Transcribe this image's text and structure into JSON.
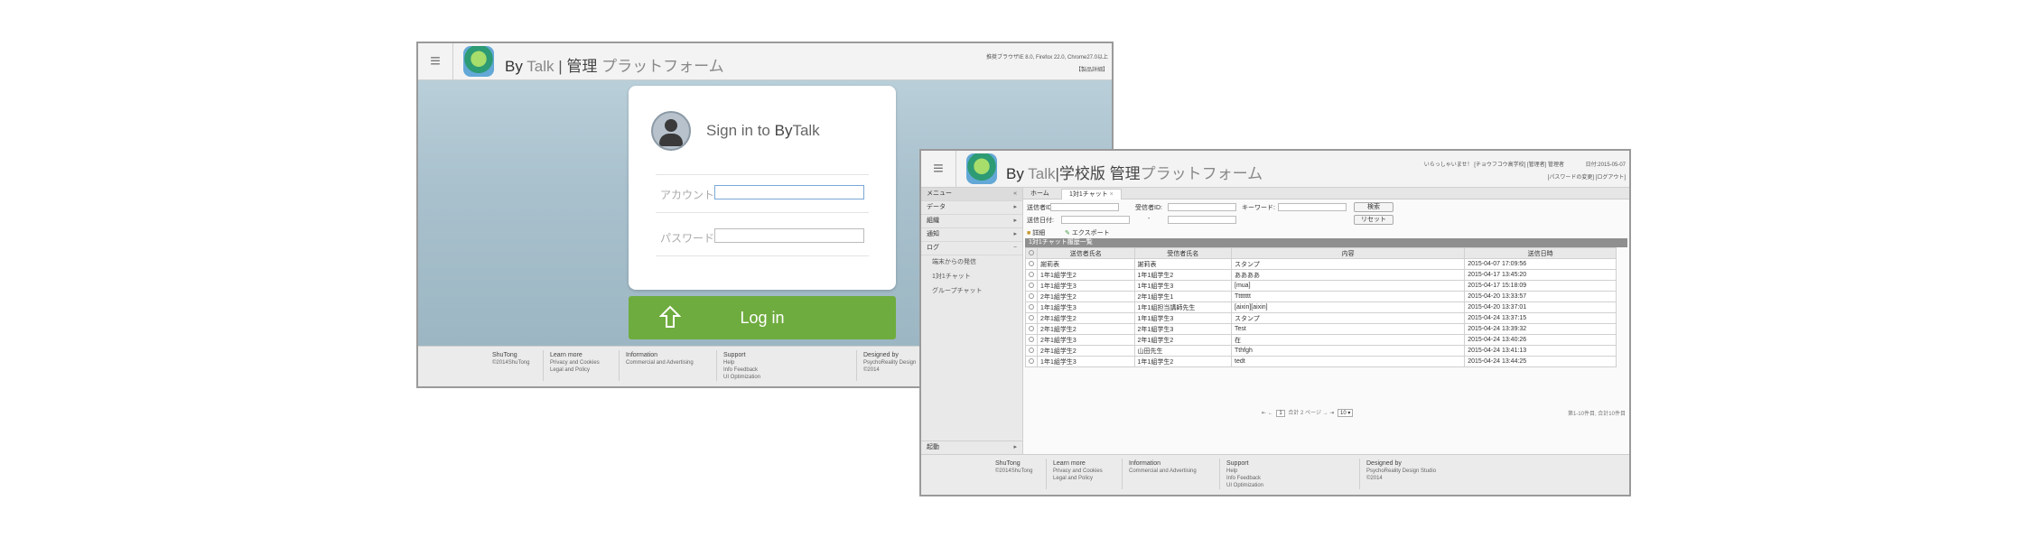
{
  "login_window": {
    "brand": {
      "by": "By",
      "talk": "Talk",
      "sep": "|",
      "admin": "管理",
      "platform": "プラットフォーム"
    },
    "browser_note": "推奨ブラウザIE 8.0, Firefox 22.0, Chrome27.0以上",
    "help_link": "【製品詳細】",
    "signin": {
      "prefix": "Sign in to ",
      "by": "By",
      "talk": "Talk"
    },
    "account_label": "アカウント",
    "password_label": "パスワード",
    "login_button": "Log in",
    "footer": {
      "company": "ShuTong",
      "copyright": "©2014ShuTong",
      "learn": {
        "title": "Learn more",
        "items": [
          "Privacy and Cookies",
          "Legal and Policy"
        ]
      },
      "info": {
        "title": "Information",
        "items": [
          "Commercial and Advertising"
        ]
      },
      "support": {
        "title": "Support",
        "items": [
          "Help",
          "Info Feedback",
          "UI Optimization"
        ]
      },
      "designed": {
        "title": "Designed by",
        "items": [
          "PsychoReality Design",
          "©2014"
        ]
      }
    }
  },
  "admin_window": {
    "brand": {
      "by": "By",
      "talk": "Talk",
      "sep": "|",
      "school": "学校版",
      "admin": "管理",
      "platform": "プラットフォーム"
    },
    "user_info": "いらっしゃいませ！ [チョウフコウ高学校] [管理者] 管理者",
    "date": "日付:2015-05-07",
    "links": "[パスワードの変更] [ログアウト]",
    "sidebar": {
      "menu": "メニュー",
      "collapse": "«",
      "items": [
        {
          "label": "データ",
          "arrow": "▸"
        },
        {
          "label": "組織",
          "arrow": "▸"
        },
        {
          "label": "通知",
          "arrow": "▸"
        },
        {
          "label": "ログ",
          "arrow": "−"
        }
      ],
      "subitems": [
        "端末からの発信",
        "1対1チャット",
        "グループチャット"
      ],
      "bottom": {
        "label": "起動",
        "arrow": "▸"
      }
    },
    "tabs": [
      "ホーム",
      "1対1チャット"
    ],
    "tab_close": "×",
    "filters": {
      "sender_id": "送信者ID:",
      "receiver_id": "受信者ID:",
      "keyword": "キーワード:",
      "date": "送信日付:",
      "dash": "-",
      "search": "検索",
      "reset": "リセット",
      "detail": "詳細",
      "export": "エクスポート"
    },
    "table": {
      "title": "1対1チャット履歴一覧",
      "headers": [
        "送信者氏名",
        "受信者氏名",
        "内容",
        "送信日時"
      ],
      "rows": [
        [
          "謝莉表",
          "謝莉表",
          "スタンプ",
          "2015-04-07 17:09:56"
        ],
        [
          "1年1組学生2",
          "1年1組学生2",
          "ああああ",
          "2015-04-17 13:45:20"
        ],
        [
          "1年1組学生3",
          "1年1組学生3",
          "[mua]",
          "2015-04-17 15:18:09"
        ],
        [
          "2年1組学生2",
          "2年1組学生1",
          "Tttttttt",
          "2015-04-20 13:33:57"
        ],
        [
          "1年1組学生3",
          "1年1組担当講師先生",
          "[aixin][aixin]",
          "2015-04-20 13:37:01"
        ],
        [
          "2年1組学生2",
          "1年1組学生3",
          "スタンプ",
          "2015-04-24 13:37:15"
        ],
        [
          "2年1組学生2",
          "2年1組学生3",
          "Test",
          "2015-04-24 13:39:32"
        ],
        [
          "2年1組学生3",
          "2年1組学生2",
          "在",
          "2015-04-24 13:40:26"
        ],
        [
          "2年1組学生2",
          "山田先生",
          "Tthfgh",
          "2015-04-24 13:41:13"
        ],
        [
          "1年1組学生3",
          "1年1組学生2",
          "tedt",
          "2015-04-24 13:44:25"
        ]
      ]
    },
    "pager": {
      "nav_prev": "⇤ ←",
      "page": "1",
      "total": "合計 2 ページ",
      "nav_next": "→ ⇥",
      "size": "10 ▾",
      "summary": "第1-10件目, 合計10件目"
    },
    "footer": {
      "company": "ShuTong",
      "copyright": "©2014ShuTong",
      "learn": {
        "title": "Learn more",
        "items": [
          "Privacy and Cookies",
          "Legal and Policy"
        ]
      },
      "info": {
        "title": "Information",
        "items": [
          "Commercial and Advertising"
        ]
      },
      "support": {
        "title": "Support",
        "items": [
          "Help",
          "Info Feedback",
          "UI Optimization"
        ]
      },
      "designed": {
        "title": "Designed by",
        "items": [
          "PsychoReality Design Studio",
          "©2014"
        ]
      }
    }
  }
}
